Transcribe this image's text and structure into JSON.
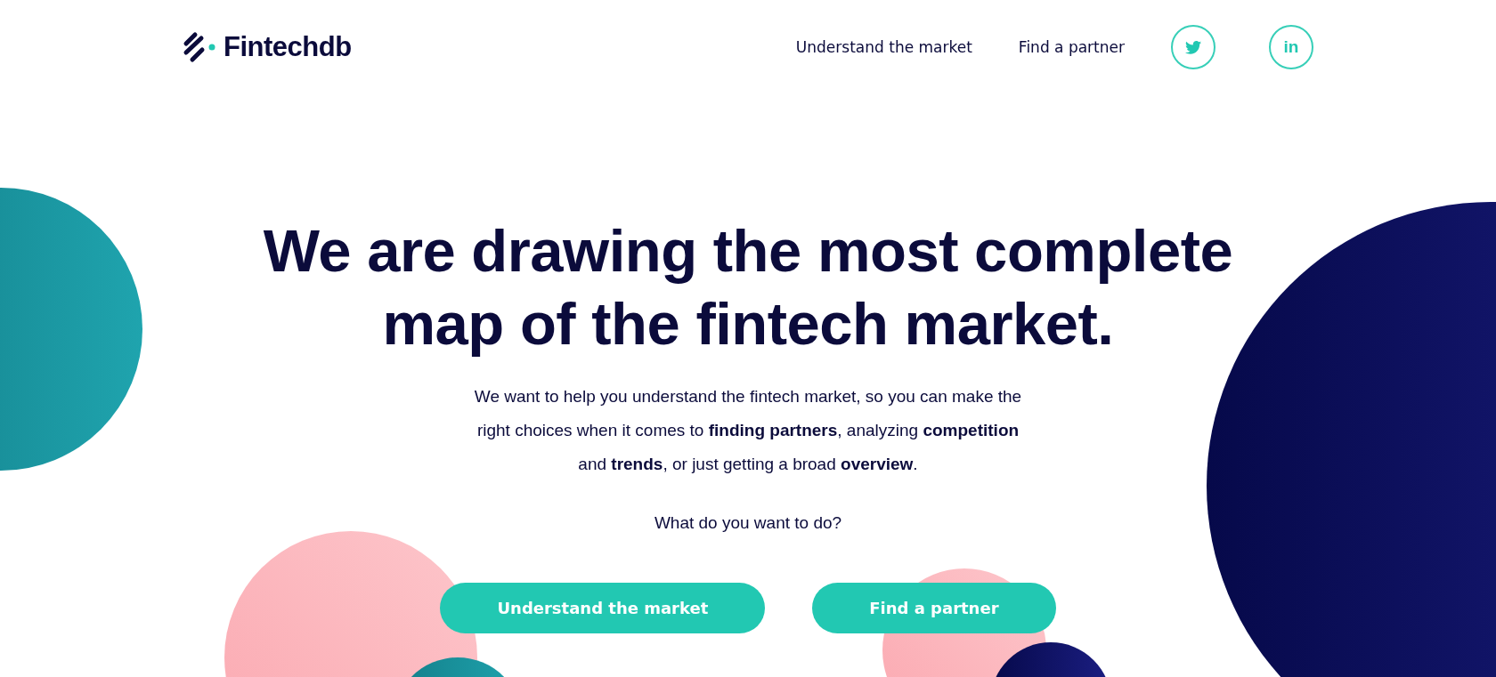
{
  "header": {
    "logo": "Fintechdb",
    "nav": [
      {
        "label": "Understand the market"
      },
      {
        "label": "Find a partner"
      }
    ],
    "social": [
      {
        "kind": "twitter"
      },
      {
        "kind": "linkedin",
        "label": "in"
      }
    ]
  },
  "hero": {
    "headline": [
      "We are drawing the most complete",
      "map of the fintech market."
    ],
    "intro": "We want to help you understand the fintech market, so you can make the right choices when it comes to **finding partners**, analyzing **competition** and **trends**, or just getting a broad **overview**.",
    "question": "What do you want to do?",
    "buttons": [
      "Understand the market",
      "Find a partner"
    ]
  }
}
